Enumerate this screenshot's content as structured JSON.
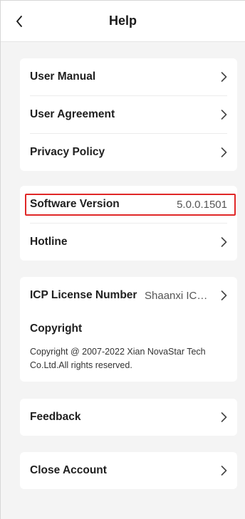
{
  "header": {
    "title": "Help"
  },
  "card1": {
    "items": [
      {
        "label": "User Manual"
      },
      {
        "label": "User Agreement"
      },
      {
        "label": "Privacy Policy"
      }
    ]
  },
  "card2": {
    "software_version_label": "Software Version",
    "software_version_value": "5.0.0.1501",
    "hotline_label": "Hotline"
  },
  "card3": {
    "icp_label": "ICP License Number",
    "icp_value": "Shaanxi ICP…",
    "copyright_title": "Copyright",
    "copyright_text": "Copyright @ 2007-2022 Xian NovaStar Tech Co.Ltd.All rights reserved."
  },
  "card4": {
    "feedback_label": "Feedback"
  },
  "card5": {
    "close_account_label": "Close Account"
  },
  "icons": {
    "back": "chevron-left-icon",
    "row_arrow": "chevron-right-icon"
  },
  "colors": {
    "highlight": "#e02727",
    "background": "#f4f4f4"
  }
}
